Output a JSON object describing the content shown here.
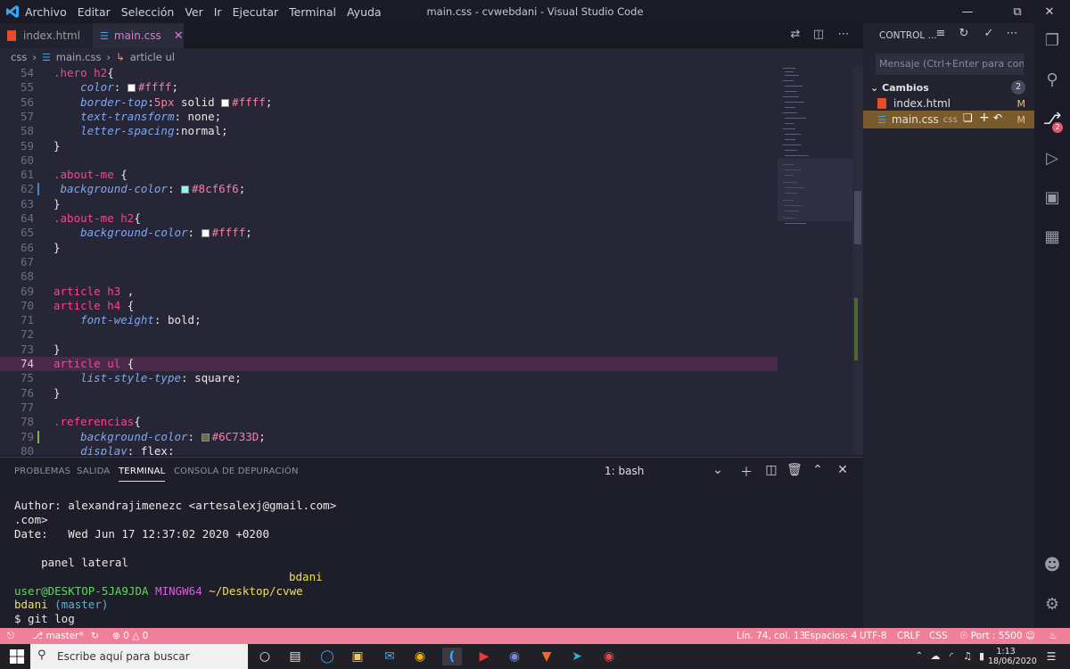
{
  "titlebar": {
    "menu": [
      "Archivo",
      "Editar",
      "Selección",
      "Ver",
      "Ir",
      "Ejecutar",
      "Terminal",
      "Ayuda"
    ],
    "title": "main.css - cvwebdani - Visual Studio Code"
  },
  "tabs": [
    {
      "label": "index.html"
    },
    {
      "label": "main.css"
    }
  ],
  "breadcrumb": [
    "css",
    "main.css",
    "article ul"
  ],
  "editor": {
    "lines": [
      {
        "n": "54",
        "code": [
          {
            "c": "sel",
            "t": ".hero h2"
          },
          {
            "c": "punc",
            "t": "{"
          }
        ]
      },
      {
        "n": "55",
        "code": [
          {
            "c": "val",
            "t": "    "
          },
          {
            "c": "prop",
            "t": "color"
          },
          {
            "c": "punc",
            "t": ": "
          },
          {
            "c": "sw",
            "color": "#ffffff"
          },
          {
            "c": "num",
            "t": "#ffff"
          },
          {
            "c": "punc",
            "t": ";"
          }
        ]
      },
      {
        "n": "56",
        "code": [
          {
            "c": "val",
            "t": "    "
          },
          {
            "c": "prop",
            "t": "border-top"
          },
          {
            "c": "punc",
            "t": ":"
          },
          {
            "c": "num",
            "t": "5px"
          },
          {
            "c": "val",
            "t": " solid "
          },
          {
            "c": "sw",
            "color": "#ffffff"
          },
          {
            "c": "num",
            "t": "#ffff"
          },
          {
            "c": "punc",
            "t": ";"
          }
        ]
      },
      {
        "n": "57",
        "code": [
          {
            "c": "val",
            "t": "    "
          },
          {
            "c": "prop",
            "t": "text-transform"
          },
          {
            "c": "punc",
            "t": ": "
          },
          {
            "c": "val",
            "t": "none;"
          }
        ]
      },
      {
        "n": "58",
        "code": [
          {
            "c": "val",
            "t": "    "
          },
          {
            "c": "prop",
            "t": "letter-spacing"
          },
          {
            "c": "punc",
            "t": ":"
          },
          {
            "c": "val",
            "t": "normal;"
          }
        ]
      },
      {
        "n": "59",
        "code": [
          {
            "c": "punc",
            "t": "}"
          }
        ]
      },
      {
        "n": "60",
        "code": []
      },
      {
        "n": "61",
        "code": [
          {
            "c": "sel",
            "t": ".about-me"
          },
          {
            "c": "punc",
            "t": " {"
          }
        ]
      },
      {
        "n": "62",
        "code": [
          {
            "c": "val",
            "t": " "
          },
          {
            "c": "prop",
            "t": "background-color"
          },
          {
            "c": "punc",
            "t": ": "
          },
          {
            "c": "sw",
            "color": "#8cf6f6"
          },
          {
            "c": "num",
            "t": "#8cf6f6"
          },
          {
            "c": "punc",
            "t": ";"
          }
        ]
      },
      {
        "n": "63",
        "code": [
          {
            "c": "punc",
            "t": "}"
          }
        ]
      },
      {
        "n": "64",
        "code": [
          {
            "c": "sel",
            "t": ".about-me h2"
          },
          {
            "c": "punc",
            "t": "{"
          }
        ]
      },
      {
        "n": "65",
        "code": [
          {
            "c": "val",
            "t": "    "
          },
          {
            "c": "prop",
            "t": "background-color"
          },
          {
            "c": "punc",
            "t": ": "
          },
          {
            "c": "sw",
            "color": "#ffffff"
          },
          {
            "c": "num",
            "t": "#ffff"
          },
          {
            "c": "punc",
            "t": ";"
          }
        ]
      },
      {
        "n": "66",
        "code": [
          {
            "c": "punc",
            "t": "}"
          }
        ]
      },
      {
        "n": "67",
        "code": []
      },
      {
        "n": "68",
        "code": []
      },
      {
        "n": "69",
        "code": [
          {
            "c": "sel",
            "t": "article h3"
          },
          {
            "c": "punc",
            "t": " ,"
          }
        ]
      },
      {
        "n": "70",
        "code": [
          {
            "c": "sel",
            "t": "article h4"
          },
          {
            "c": "punc",
            "t": " {"
          }
        ]
      },
      {
        "n": "71",
        "code": [
          {
            "c": "val",
            "t": "    "
          },
          {
            "c": "prop",
            "t": "font-weight"
          },
          {
            "c": "punc",
            "t": ": "
          },
          {
            "c": "val",
            "t": "bold;"
          }
        ]
      },
      {
        "n": "72",
        "code": []
      },
      {
        "n": "73",
        "code": [
          {
            "c": "punc",
            "t": "}"
          }
        ]
      },
      {
        "n": "74",
        "code": [
          {
            "c": "sel",
            "t": "article ul"
          },
          {
            "c": "punc",
            "t": " {"
          }
        ],
        "highlight": true
      },
      {
        "n": "75",
        "code": [
          {
            "c": "val",
            "t": "    "
          },
          {
            "c": "prop",
            "t": "list-style-type"
          },
          {
            "c": "punc",
            "t": ": "
          },
          {
            "c": "val",
            "t": "square;"
          }
        ]
      },
      {
        "n": "76",
        "code": [
          {
            "c": "punc",
            "t": "}"
          }
        ]
      },
      {
        "n": "77",
        "code": []
      },
      {
        "n": "78",
        "code": [
          {
            "c": "sel",
            "t": ".referencias"
          },
          {
            "c": "punc",
            "t": "{"
          }
        ]
      },
      {
        "n": "79",
        "code": [
          {
            "c": "val",
            "t": "    "
          },
          {
            "c": "prop",
            "t": "background-color"
          },
          {
            "c": "punc",
            "t": ": "
          },
          {
            "c": "sw",
            "color": "#6C733D"
          },
          {
            "c": "num",
            "t": "#6C733D"
          },
          {
            "c": "punc",
            "t": ";"
          }
        ]
      },
      {
        "n": "80",
        "code": [
          {
            "c": "val",
            "t": "    "
          },
          {
            "c": "prop",
            "t": "display"
          },
          {
            "c": "punc",
            "t": ": "
          },
          {
            "c": "val",
            "t": "flex;"
          }
        ]
      }
    ]
  },
  "panel": {
    "tabs": [
      "PROBLEMAS",
      "SALIDA",
      "TERMINAL",
      "CONSOLA DE DEPURACIÓN"
    ],
    "terminal_select": "1: bash",
    "terminal": {
      "l1": "Author: alexandrajimenezc <artesalexj@gmail.com>",
      "l2": ".com>",
      "l3": "Date:   Wed Jun 17 12:37:02 2020 +0200",
      "l4": "    panel lateral",
      "l5": "bdani",
      "l6_user": "user@DESKTOP-5JA9JDA",
      "l6_env": "MINGW64",
      "l6_path": "~/Desktop/cvwe",
      "l7_dir": "bdani",
      "l7_branch": "(master)",
      "l8": "$ git log"
    }
  },
  "sidebar": {
    "title": "CONTROL ...",
    "commit_placeholder": "Mensaje (Ctrl+Enter para confi...",
    "changes_label": "Cambios",
    "changes_count": "2",
    "files": [
      {
        "name": "index.html",
        "status": "M"
      },
      {
        "name": "main.css",
        "ext": "css",
        "status": "M"
      }
    ]
  },
  "activitybar": {
    "scm_badge": "2"
  },
  "statusbar": {
    "branch": "master*",
    "errors": "0",
    "warnings": "0",
    "position": "Lín. 74, col. 13",
    "spaces": "Espacios: 4",
    "encoding": "UTF-8",
    "eol": "CRLF",
    "language": "CSS",
    "port": "Port : 5500"
  },
  "taskbar": {
    "search_placeholder": "Escribe aquí para buscar",
    "time": "1:13",
    "date": "18/06/2020"
  },
  "colors": {
    "accent": "#f07f9a",
    "selector": "#f5468e",
    "property": "#7ea7f0"
  }
}
